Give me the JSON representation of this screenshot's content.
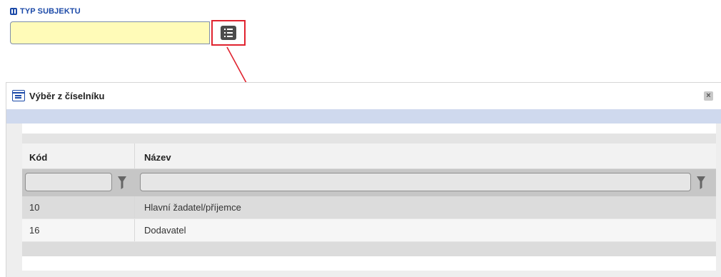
{
  "field": {
    "label": "TYP SUBJEKTU",
    "value": "",
    "lock_icon": "lock-icon",
    "list_button_icon": "list-icon"
  },
  "dialog": {
    "title": "Výběr z číselníku",
    "icon": "list-window-icon",
    "close_icon": "close-icon"
  },
  "table": {
    "columns": [
      "Kód",
      "Název"
    ],
    "filters": {
      "kod": "",
      "nazev": ""
    },
    "filter_icon": "funnel-icon",
    "rows": [
      {
        "kod": "10",
        "nazev": "Hlavní žadatel/příjemce"
      },
      {
        "kod": "16",
        "nazev": "Dodavatel"
      }
    ]
  },
  "colors": {
    "label_blue": "#1c4aa8",
    "input_bg": "#fffbb8",
    "highlight_red": "#e0232f",
    "dialog_blue": "#cfd9ee"
  }
}
